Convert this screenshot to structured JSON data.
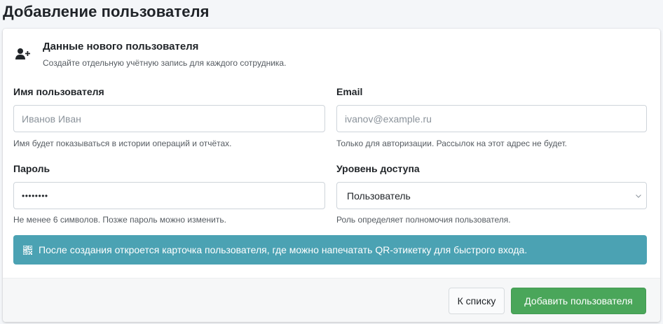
{
  "page": {
    "title": "Добавление пользователя"
  },
  "card": {
    "header": {
      "title": "Данные нового пользователя",
      "subtitle": "Создайте отдельную учётную запись для каждого сотрудника.",
      "icon": "user-plus-icon"
    },
    "fields": {
      "username": {
        "label": "Имя пользователя",
        "placeholder": "Иванов Иван",
        "hint": "Имя будет показываться в истории операций и отчётах."
      },
      "email": {
        "label": "Email",
        "placeholder": "ivanov@example.ru",
        "hint": "Только для авторизации. Рассылок на этот адрес не будет."
      },
      "password": {
        "label": "Пароль",
        "value": "••••••••",
        "hint": "Не менее 6 символов. Позже пароль можно изменить."
      },
      "access_level": {
        "label": "Уровень доступа",
        "selected": "Пользователь",
        "hint": "Роль определяет полномочия пользователя.",
        "icon": "chevron-down-icon"
      }
    },
    "info": {
      "icon": "qr-code-icon",
      "text": "После создания откроется карточка пользователя, где можно напечатать QR-этикетку для быстрого входа."
    },
    "footer": {
      "back_label": "К списку",
      "submit_label": "Добавить пользователя"
    }
  },
  "colors": {
    "info_bg": "#4ba2b3",
    "success": "#4aa65a",
    "page_bg": "#f4f6f9"
  }
}
